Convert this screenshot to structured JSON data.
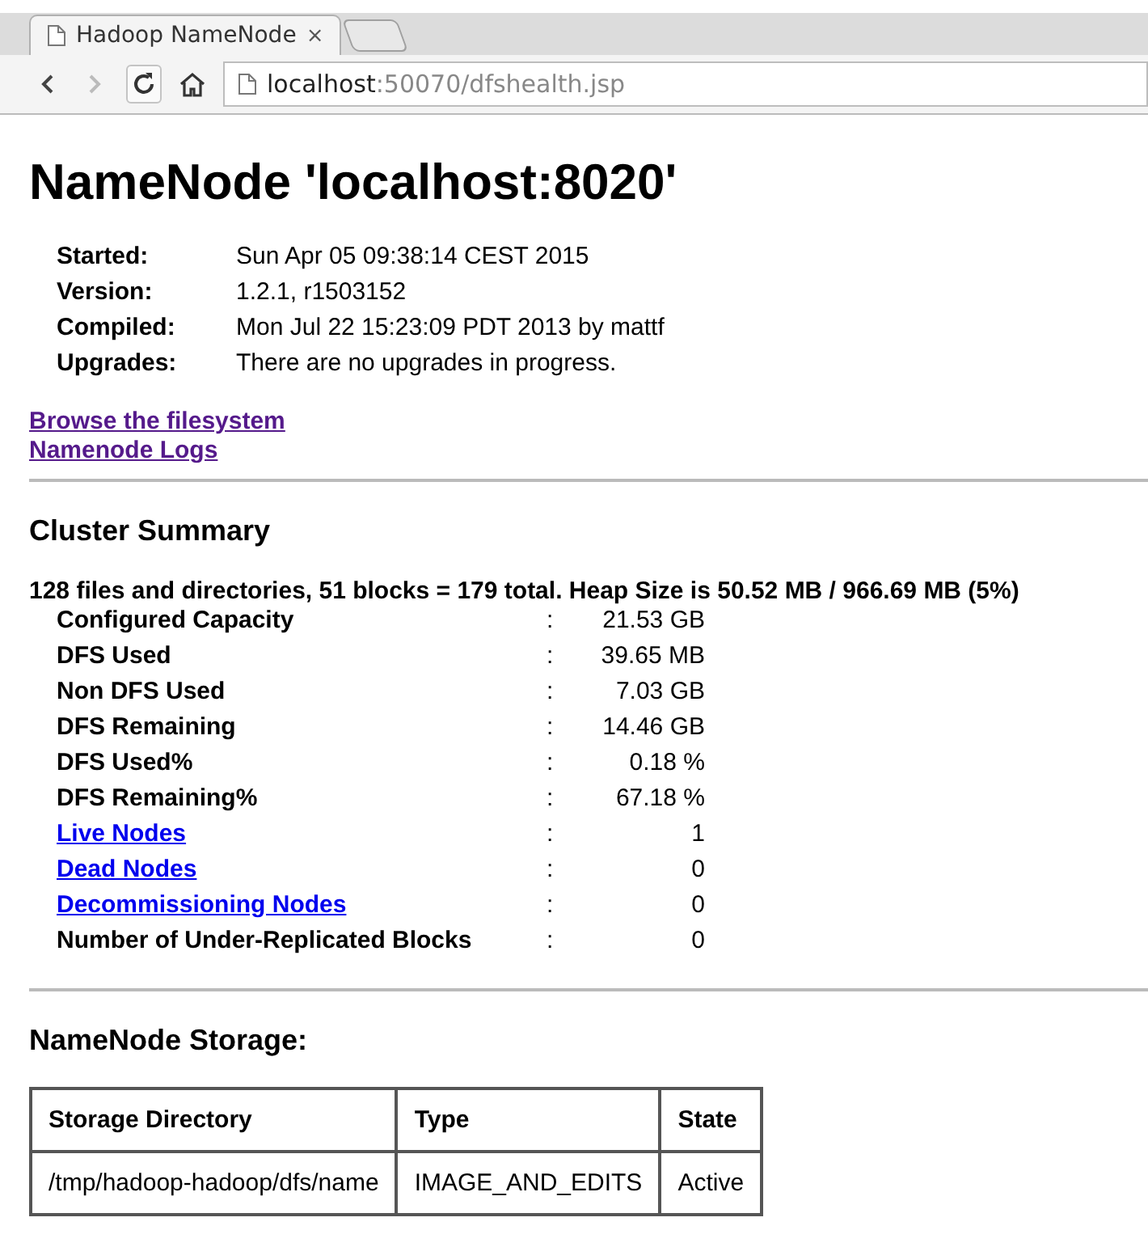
{
  "browser": {
    "tab_title": "Hadoop NameNode",
    "tab_close": "×",
    "url_host": "localhost",
    "url_path": ":50070/dfshealth.jsp"
  },
  "title": "NameNode 'localhost:8020'",
  "info": [
    {
      "label": "Started:",
      "value": "Sun Apr 05 09:38:14 CEST 2015"
    },
    {
      "label": "Version:",
      "value": "1.2.1, r1503152"
    },
    {
      "label": "Compiled:",
      "value": "Mon Jul 22 15:23:09 PDT 2013 by mattf"
    },
    {
      "label": "Upgrades:",
      "value": "There are no upgrades in progress."
    }
  ],
  "links": [
    {
      "text": "Browse the filesystem",
      "visited": true
    },
    {
      "text": "Namenode Logs",
      "visited": true
    }
  ],
  "cluster_summary": {
    "heading": "Cluster Summary",
    "summary": "128 files and directories, 51 blocks = 179 total. Heap Size is 50.52 MB / 966.69 MB (5%)",
    "rows": [
      {
        "label": "Configured Capacity",
        "link": false,
        "separator": ":",
        "value": "21.53 GB"
      },
      {
        "label": "DFS Used",
        "link": false,
        "separator": ":",
        "value": "39.65 MB"
      },
      {
        "label": "Non DFS Used",
        "link": false,
        "separator": ":",
        "value": "7.03 GB"
      },
      {
        "label": "DFS Remaining",
        "link": false,
        "separator": ":",
        "value": "14.46 GB"
      },
      {
        "label": "DFS Used%",
        "link": false,
        "separator": ":",
        "value": "0.18 %"
      },
      {
        "label": "DFS Remaining%",
        "link": false,
        "separator": ":",
        "value": "67.18 %"
      },
      {
        "label": "Live Nodes",
        "link": true,
        "separator": ":",
        "value": "1"
      },
      {
        "label": "Dead Nodes",
        "link": true,
        "separator": ":",
        "value": "0"
      },
      {
        "label": "Decommissioning Nodes",
        "link": true,
        "separator": ":",
        "value": "0"
      },
      {
        "label": "Number of Under-Replicated Blocks",
        "link": false,
        "separator": ":",
        "value": "0"
      }
    ]
  },
  "storage": {
    "heading": "NameNode Storage:",
    "columns": [
      "Storage Directory",
      "Type",
      "State"
    ],
    "rows": [
      [
        "/tmp/hadoop-hadoop/dfs/name",
        "IMAGE_AND_EDITS",
        "Active"
      ]
    ]
  }
}
